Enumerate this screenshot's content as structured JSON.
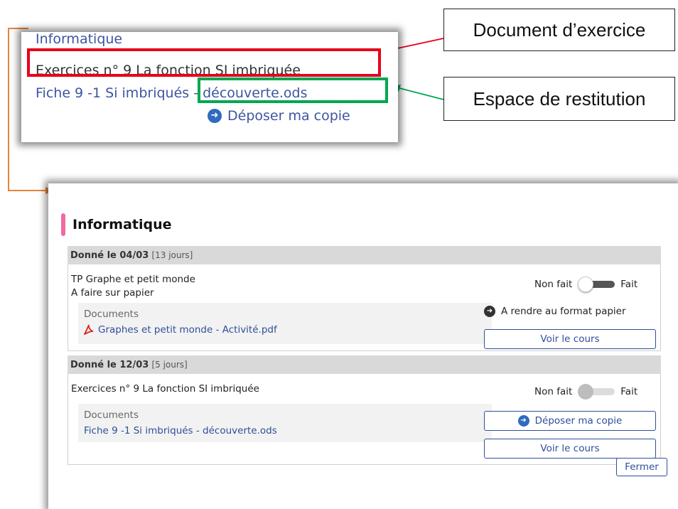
{
  "zoom_card": {
    "subject": "Informatique",
    "title": "Exercices n° 9 La fonction SI imbriquée",
    "file": "Fiche 9 -1 Si imbriqués - découverte.ods",
    "deposit_label": "Déposer ma copie"
  },
  "callouts": {
    "document_label": "Document d’exercice",
    "restitution_label": "Espace de restitution"
  },
  "colors": {
    "red_highlight": "#e8001c",
    "green_highlight": "#00a850",
    "connector_orange": "#e8833a",
    "link_blue": "#2f4f9a",
    "subject_pink": "#f06aa4"
  },
  "modal": {
    "subject": "Informatique",
    "groups": [
      {
        "given_label": "Donné le 04/03",
        "given_extra": "[13 jours]",
        "task_lines": [
          "TP Graphe et petit monde",
          "A faire sur papier"
        ],
        "status_off": "Non fait",
        "status_on": "Fait",
        "docs_label": "Documents",
        "doc_file": "Graphes et petit monde - Activité.pdf",
        "note": "A rendre au format papier",
        "view_button": "Voir le cours"
      },
      {
        "given_label": "Donné le 12/03",
        "given_extra": "[5 jours]",
        "task_lines": [
          "Exercices n° 9 La fonction SI imbriquée"
        ],
        "status_off": "Non fait",
        "status_on": "Fait",
        "docs_label": "Documents",
        "doc_file": "Fiche 9 -1 Si imbriqués - découverte.ods",
        "deposit_button": "Déposer ma copie",
        "view_button": "Voir le cours"
      }
    ],
    "close_button": "Fermer"
  }
}
